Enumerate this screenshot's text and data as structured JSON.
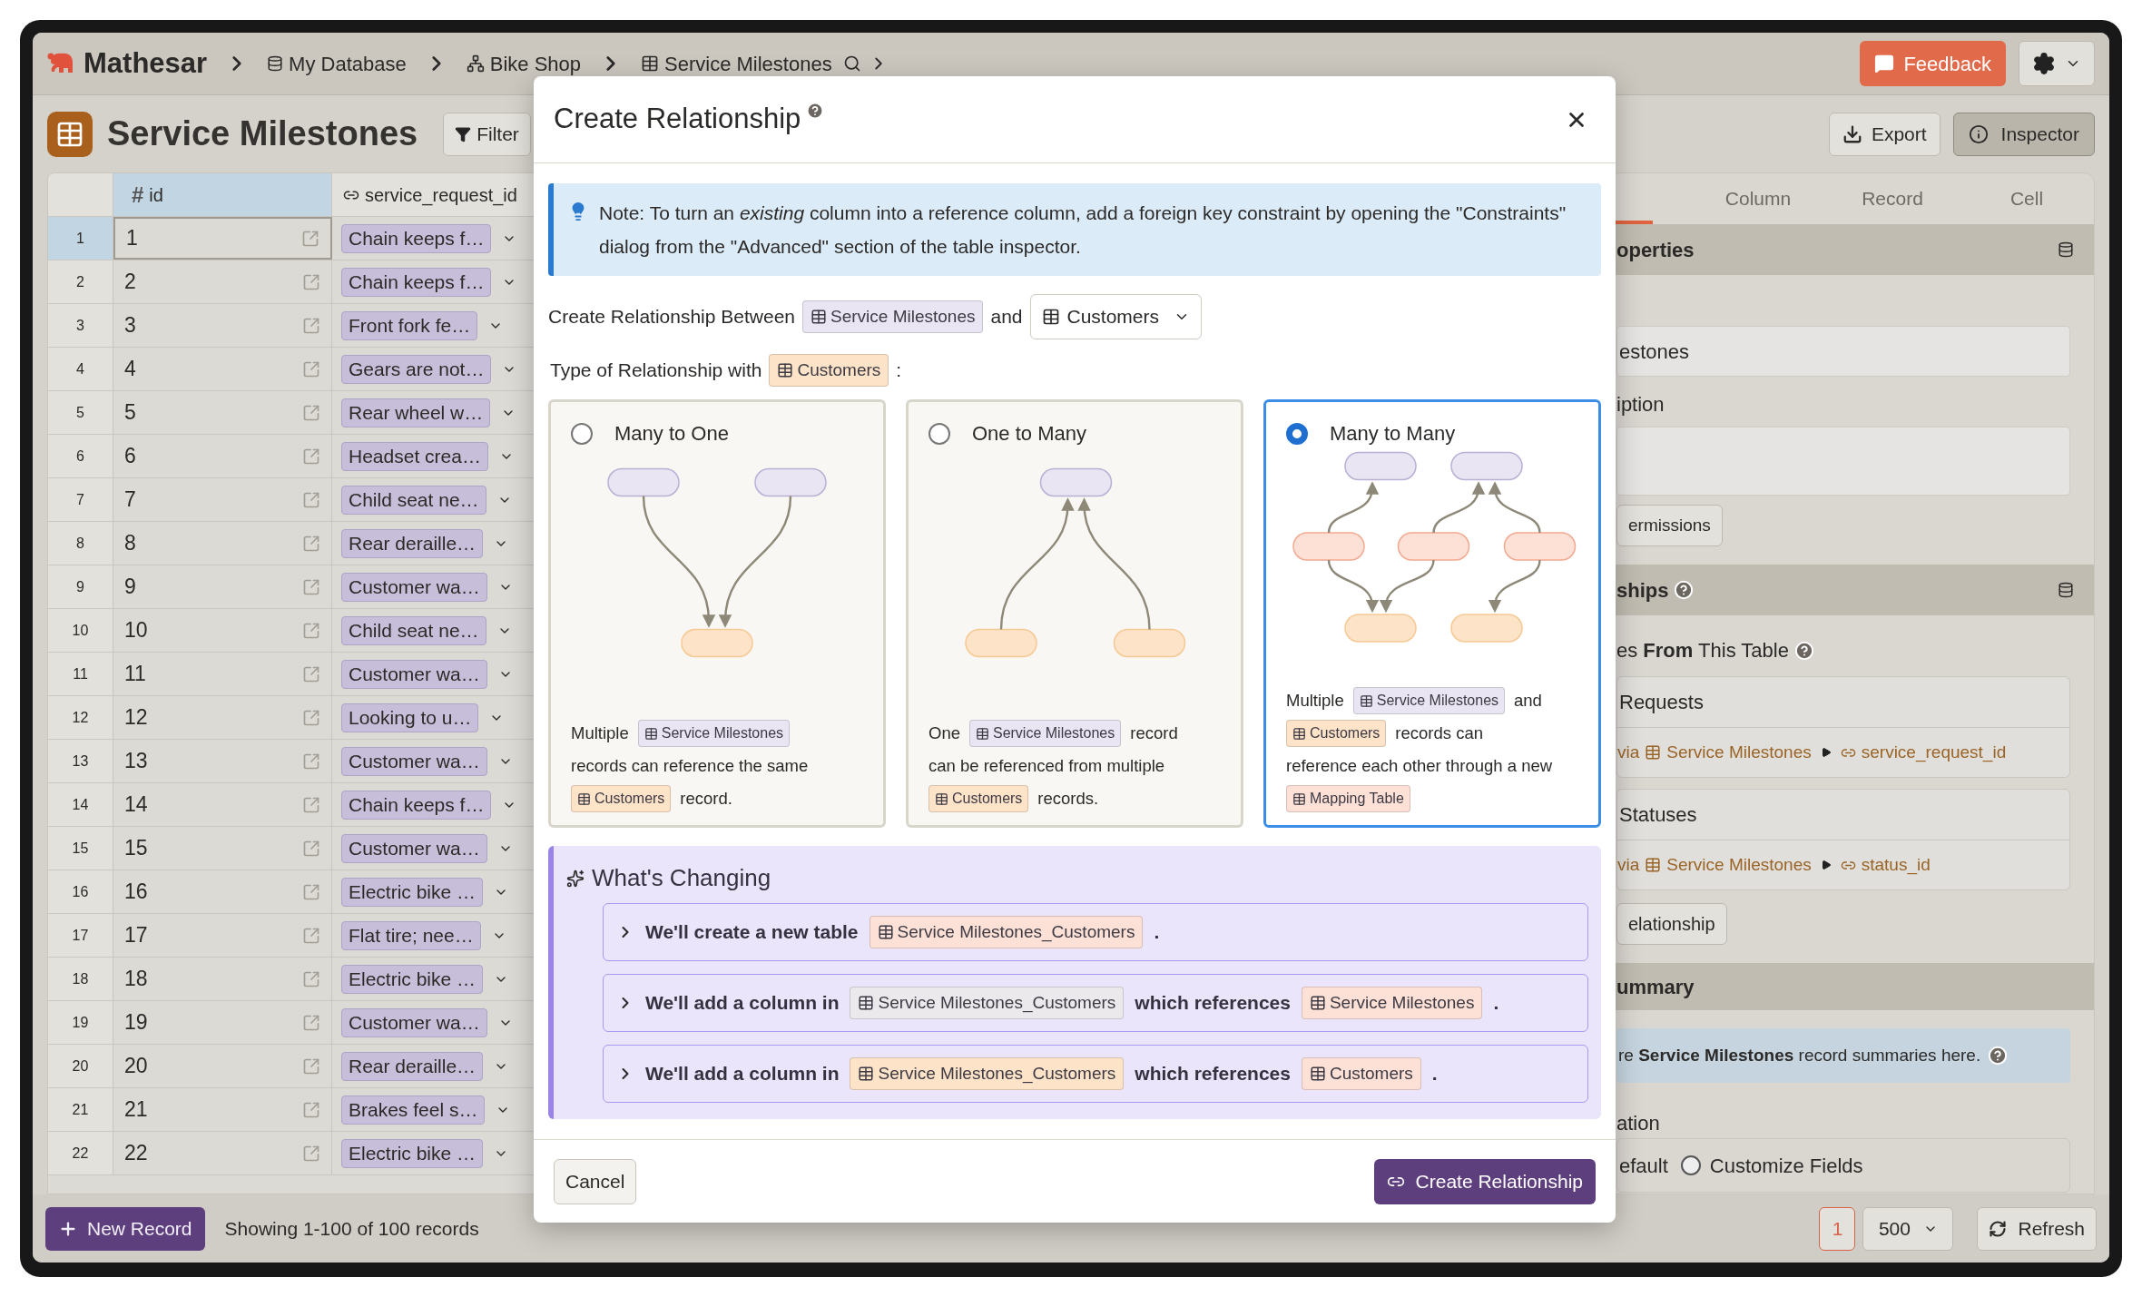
{
  "header": {
    "app_name": "Mathesar",
    "breadcrumbs": [
      {
        "label": "My Database",
        "kind": "database"
      },
      {
        "label": "Bike Shop",
        "kind": "schema"
      },
      {
        "label": "Service Milestones",
        "kind": "table"
      }
    ],
    "feedback_button": "Feedback"
  },
  "page": {
    "title": "Service Milestones",
    "filter_button": "Filter",
    "export_button": "Export",
    "inspector_button": "Inspector"
  },
  "table": {
    "columns": [
      {
        "label": "id",
        "kind": "number",
        "type_mark": "#",
        "selected": true
      },
      {
        "label": "service_request_id",
        "kind": "link",
        "selected": false
      }
    ],
    "rows": [
      {
        "number": "1",
        "id": "1",
        "service_request": "Chain keeps f…",
        "selected": true
      },
      {
        "number": "2",
        "id": "2",
        "service_request": "Chain keeps f…",
        "selected": false
      },
      {
        "number": "3",
        "id": "3",
        "service_request": "Front fork fe…",
        "selected": false
      },
      {
        "number": "4",
        "id": "4",
        "service_request": "Gears are not…",
        "selected": false
      },
      {
        "number": "5",
        "id": "5",
        "service_request": "Rear wheel w…",
        "selected": false
      },
      {
        "number": "6",
        "id": "6",
        "service_request": "Headset crea…",
        "selected": false
      },
      {
        "number": "7",
        "id": "7",
        "service_request": "Child seat ne…",
        "selected": false
      },
      {
        "number": "8",
        "id": "8",
        "service_request": "Rear deraille…",
        "selected": false
      },
      {
        "number": "9",
        "id": "9",
        "service_request": "Customer wa…",
        "selected": false
      },
      {
        "number": "10",
        "id": "10",
        "service_request": "Child seat ne…",
        "selected": false
      },
      {
        "number": "11",
        "id": "11",
        "service_request": "Customer wa…",
        "selected": false
      },
      {
        "number": "12",
        "id": "12",
        "service_request": "Looking to u…",
        "selected": false
      },
      {
        "number": "13",
        "id": "13",
        "service_request": "Customer wa…",
        "selected": false
      },
      {
        "number": "14",
        "id": "14",
        "service_request": "Chain keeps f…",
        "selected": false
      },
      {
        "number": "15",
        "id": "15",
        "service_request": "Customer wa…",
        "selected": false
      },
      {
        "number": "16",
        "id": "16",
        "service_request": "Electric bike …",
        "selected": false
      },
      {
        "number": "17",
        "id": "17",
        "service_request": "Flat tire; nee…",
        "selected": false
      },
      {
        "number": "18",
        "id": "18",
        "service_request": "Electric bike …",
        "selected": false
      },
      {
        "number": "19",
        "id": "19",
        "service_request": "Customer wa…",
        "selected": false
      },
      {
        "number": "20",
        "id": "20",
        "service_request": "Rear deraille…",
        "selected": false
      },
      {
        "number": "21",
        "id": "21",
        "service_request": "Brakes feel s…",
        "selected": false
      },
      {
        "number": "22",
        "id": "22",
        "service_request": "Electric bike …",
        "selected": false
      }
    ]
  },
  "footer": {
    "new_record_button": "New Record",
    "record_count": "Showing 1-100 of 100 records",
    "page": "1",
    "page_size": "500",
    "refresh_button": "Refresh"
  },
  "inspector": {
    "partial_tab": {
      "selected": true
    },
    "tabs": [
      {
        "label": "Column",
        "selected": false
      },
      {
        "label": "Record",
        "selected": false
      },
      {
        "label": "Cell",
        "selected": false
      }
    ],
    "properties_heading": "operties",
    "name_value": "estones",
    "description_label": "iption",
    "permissions_button": "ermissions",
    "relationships_heading": "ships",
    "from_heading": "es **From** This Table",
    "links": [
      {
        "title": "Requests",
        "via": "via",
        "table": "Service Milestones",
        "column": "service_request_id"
      },
      {
        "title": "Statuses",
        "via": "via",
        "table": "Service Milestones",
        "column": "status_id"
      }
    ],
    "relationship_button": "elationship",
    "summary_heading": "ummary",
    "summary_info": "re **Service Milestones** record summaries here.",
    "template_legend": "ation",
    "default_fragment": "efault",
    "customize_option": {
      "label": "Customize Fields",
      "selected": false
    }
  },
  "dialog": {
    "title": "Create Relationship",
    "note": "Note: To turn an *existing* column into a reference column, add a foreign key constraint by opening the \"Constraints\" dialog from the \"Advanced\" section of the table inspector.",
    "between_label": "Create Relationship Between",
    "this_table": {
      "name": "Service Milestones",
      "color": "#e9e5f3"
    },
    "and_label": "and",
    "target_table": "Customers",
    "type_label": "Type of Relationship with",
    "type_table": {
      "name": "Customers",
      "color": "#fde3c8"
    },
    "type_suffix": ":",
    "options": [
      {
        "label": "Many to One",
        "kind": "many-to-one",
        "selected": false,
        "description": [
          {
            "kind": "text",
            "text": "Multiple"
          },
          {
            "kind": "table",
            "text": "Service Milestones",
            "color": "#e9e5f3"
          },
          {
            "kind": "text",
            "text": "records can reference the same"
          },
          {
            "kind": "table",
            "text": "Customers",
            "color": "#fde3c8"
          },
          {
            "kind": "text",
            "text": "record."
          }
        ]
      },
      {
        "label": "One to Many",
        "kind": "one-to-many",
        "selected": false,
        "description": [
          {
            "kind": "text",
            "text": "One"
          },
          {
            "kind": "table",
            "text": "Service Milestones",
            "color": "#e9e5f3"
          },
          {
            "kind": "text",
            "text": "record"
          },
          {
            "kind": "text",
            "text": "can be referenced from multiple"
          },
          {
            "kind": "table",
            "text": "Customers",
            "color": "#fde3c8"
          },
          {
            "kind": "text",
            "text": "records."
          }
        ]
      },
      {
        "label": "Many to Many",
        "kind": "many-to-many",
        "selected": true,
        "description": [
          {
            "kind": "text",
            "text": "Multiple"
          },
          {
            "kind": "table",
            "text": "Service Milestones",
            "color": "#e9e5f3"
          },
          {
            "kind": "text",
            "text": "and"
          },
          {
            "kind": "table",
            "text": "Customers",
            "color": "#fde3c8"
          },
          {
            "kind": "text",
            "text": "records can"
          },
          {
            "kind": "text",
            "text": "reference each other through a new"
          },
          {
            "kind": "table",
            "text": "Mapping Table",
            "color": "#fde0d6"
          }
        ]
      }
    ],
    "changes": {
      "title": "What's Changing",
      "items": [
        {
          "expanded": false,
          "parts": [
            {
              "kind": "text",
              "text": "We'll create a new table"
            },
            {
              "kind": "table",
              "text": "Service Milestones_Customers",
              "color": "#fde0d6"
            },
            {
              "kind": "text",
              "text": "."
            }
          ]
        },
        {
          "expanded": false,
          "parts": [
            {
              "kind": "text",
              "text": "We'll add a column in"
            },
            {
              "kind": "table",
              "text": "Service Milestones_Customers",
              "color": "#ebe9ec"
            },
            {
              "kind": "text",
              "text": "which references"
            },
            {
              "kind": "table",
              "text": "Service Milestones",
              "color": "#fde0d6"
            },
            {
              "kind": "text",
              "text": "."
            }
          ]
        },
        {
          "expanded": false,
          "parts": [
            {
              "kind": "text",
              "text": "We'll add a column in"
            },
            {
              "kind": "table",
              "text": "Service Milestones_Customers",
              "color": "#fde3c8"
            },
            {
              "kind": "text",
              "text": "which references"
            },
            {
              "kind": "table",
              "text": "Customers",
              "color": "#fde0d6"
            },
            {
              "kind": "text",
              "text": "."
            }
          ]
        }
      ]
    },
    "cancel_button": "Cancel",
    "submit_button": "Create Relationship"
  }
}
